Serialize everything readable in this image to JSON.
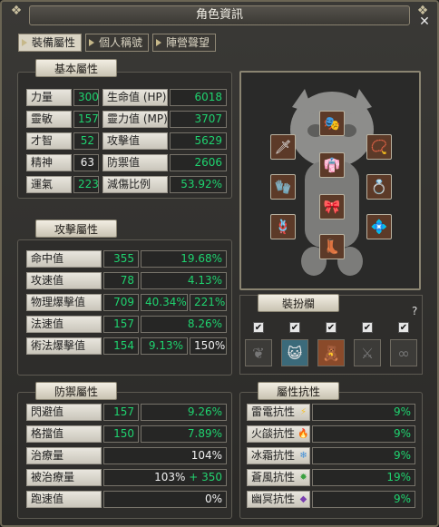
{
  "window": {
    "title": "角色資訊",
    "close": "✕"
  },
  "tabs": [
    "裝備屬性",
    "個人稱號",
    "陣營聲望"
  ],
  "basic": {
    "title": "基本屬性",
    "left": [
      {
        "label": "力量",
        "value": "300"
      },
      {
        "label": "靈敏",
        "value": "157"
      },
      {
        "label": "才智",
        "value": "52"
      },
      {
        "label": "精神",
        "value": "63"
      },
      {
        "label": "運氣",
        "value": "223"
      }
    ],
    "right": [
      {
        "label": "生命值 (HP)",
        "value": "6018"
      },
      {
        "label": "靈力值 (MP)",
        "value": "3707"
      },
      {
        "label": "攻擊值",
        "value": "5629"
      },
      {
        "label": "防禦值",
        "value": "2606"
      },
      {
        "label": "減傷比例",
        "value": "53.92%"
      }
    ]
  },
  "attack": {
    "title": "攻擊屬性",
    "rows": [
      {
        "label": "命中值",
        "v1": "355",
        "v2": "19.68%"
      },
      {
        "label": "攻速值",
        "v1": "78",
        "v2": "4.13%"
      },
      {
        "label": "物理爆擊值",
        "v1": "709",
        "v2": "40.34%",
        "v3": "221%"
      },
      {
        "label": "法速值",
        "v1": "157",
        "v2": "8.26%"
      },
      {
        "label": "術法爆擊值",
        "v1": "154",
        "v2": "9.13%",
        "v3": "150%"
      }
    ]
  },
  "defense": {
    "title": "防禦屬性",
    "rows": [
      {
        "label": "閃避值",
        "v1": "157",
        "v2": "9.26%"
      },
      {
        "label": "格擋值",
        "v1": "150",
        "v2": "7.89%"
      },
      {
        "label": "治療量",
        "v2": "104%"
      },
      {
        "label": "被治療量",
        "v2a": "103%",
        "v2b": "+ 350"
      },
      {
        "label": "跑速值",
        "v2": "0%"
      }
    ]
  },
  "dress": {
    "title": "裝扮欄",
    "help": "?",
    "checks": [
      "✔",
      "✔",
      "✔",
      "✔",
      "✔"
    ]
  },
  "resist": {
    "title": "屬性抗性",
    "rows": [
      {
        "label": "雷電抗性",
        "value": "9%",
        "icon": "⚡",
        "color": "#d89a1c"
      },
      {
        "label": "火燄抗性",
        "value": "9%",
        "icon": "🔥",
        "color": "#d24a1e"
      },
      {
        "label": "冰霜抗性",
        "value": "9%",
        "icon": "❄",
        "color": "#3f8ed8"
      },
      {
        "label": "蒼風抗性",
        "value": "19%",
        "icon": "✹",
        "color": "#3aa040"
      },
      {
        "label": "幽冥抗性",
        "value": "9%",
        "icon": "◆",
        "color": "#7a3fb0"
      }
    ]
  }
}
